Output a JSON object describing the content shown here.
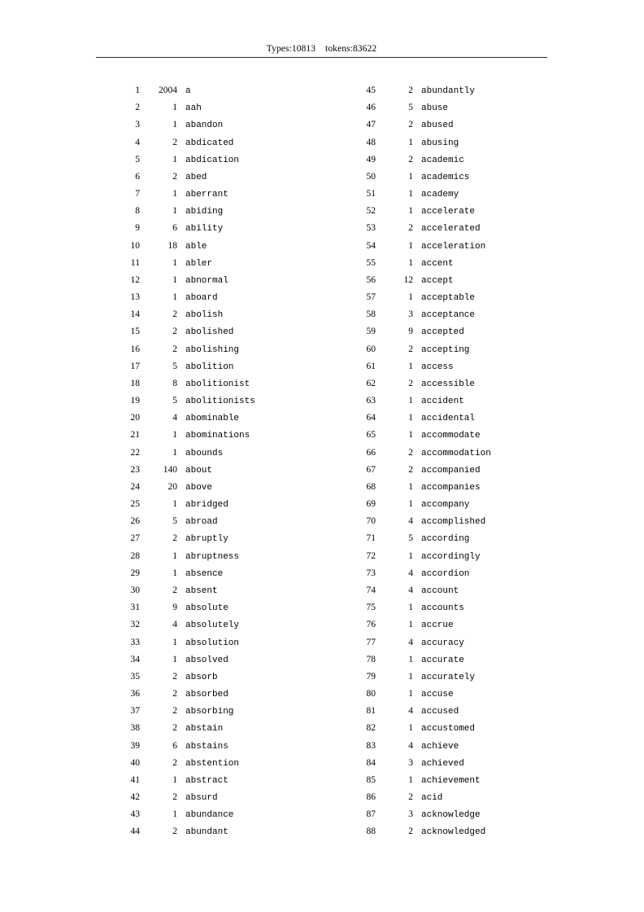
{
  "document": {
    "header": {
      "types_label": "Types:10813",
      "tokens_label": "tokens:83622",
      "full_text": "Types:10813    tokens:83622"
    },
    "columns": {
      "left": [
        {
          "rank": "1",
          "freq": "2004",
          "word": "a"
        },
        {
          "rank": "2",
          "freq": "1",
          "word": "aah"
        },
        {
          "rank": "3",
          "freq": "1",
          "word": "abandon"
        },
        {
          "rank": "4",
          "freq": "2",
          "word": "abdicated"
        },
        {
          "rank": "5",
          "freq": "1",
          "word": "abdication"
        },
        {
          "rank": "6",
          "freq": "2",
          "word": "abed"
        },
        {
          "rank": "7",
          "freq": "1",
          "word": "aberrant"
        },
        {
          "rank": "8",
          "freq": "1",
          "word": "abiding"
        },
        {
          "rank": "9",
          "freq": "6",
          "word": "ability"
        },
        {
          "rank": "10",
          "freq": "18",
          "word": "able"
        },
        {
          "rank": "11",
          "freq": "1",
          "word": "abler"
        },
        {
          "rank": "12",
          "freq": "1",
          "word": "abnormal"
        },
        {
          "rank": "13",
          "freq": "1",
          "word": "aboard"
        },
        {
          "rank": "14",
          "freq": "2",
          "word": "abolish"
        },
        {
          "rank": "15",
          "freq": "2",
          "word": "abolished"
        },
        {
          "rank": "16",
          "freq": "2",
          "word": "abolishing"
        },
        {
          "rank": "17",
          "freq": "5",
          "word": "abolition"
        },
        {
          "rank": "18",
          "freq": "8",
          "word": "abolitionist"
        },
        {
          "rank": "19",
          "freq": "5",
          "word": "abolitionists"
        },
        {
          "rank": "20",
          "freq": "4",
          "word": "abominable"
        },
        {
          "rank": "21",
          "freq": "1",
          "word": "abominations"
        },
        {
          "rank": "22",
          "freq": "1",
          "word": "abounds"
        },
        {
          "rank": "23",
          "freq": "140",
          "word": "about"
        },
        {
          "rank": "24",
          "freq": "20",
          "word": "above"
        },
        {
          "rank": "25",
          "freq": "1",
          "word": "abridged"
        },
        {
          "rank": "26",
          "freq": "5",
          "word": "abroad"
        },
        {
          "rank": "27",
          "freq": "2",
          "word": "abruptly"
        },
        {
          "rank": "28",
          "freq": "1",
          "word": "abruptness"
        },
        {
          "rank": "29",
          "freq": "1",
          "word": "absence"
        },
        {
          "rank": "30",
          "freq": "2",
          "word": "absent"
        },
        {
          "rank": "31",
          "freq": "9",
          "word": "absolute"
        },
        {
          "rank": "32",
          "freq": "4",
          "word": "absolutely"
        },
        {
          "rank": "33",
          "freq": "1",
          "word": "absolution"
        },
        {
          "rank": "34",
          "freq": "1",
          "word": "absolved"
        },
        {
          "rank": "35",
          "freq": "2",
          "word": "absorb"
        },
        {
          "rank": "36",
          "freq": "2",
          "word": "absorbed"
        },
        {
          "rank": "37",
          "freq": "2",
          "word": "absorbing"
        },
        {
          "rank": "38",
          "freq": "2",
          "word": "abstain"
        },
        {
          "rank": "39",
          "freq": "6",
          "word": "abstains"
        },
        {
          "rank": "40",
          "freq": "2",
          "word": "abstention"
        },
        {
          "rank": "41",
          "freq": "1",
          "word": "abstract"
        },
        {
          "rank": "42",
          "freq": "2",
          "word": "absurd"
        },
        {
          "rank": "43",
          "freq": "1",
          "word": "abundance"
        },
        {
          "rank": "44",
          "freq": "2",
          "word": "abundant"
        }
      ],
      "right": [
        {
          "rank": "45",
          "freq": "2",
          "word": "abundantly"
        },
        {
          "rank": "46",
          "freq": "5",
          "word": "abuse"
        },
        {
          "rank": "47",
          "freq": "2",
          "word": "abused"
        },
        {
          "rank": "48",
          "freq": "1",
          "word": "abusing"
        },
        {
          "rank": "49",
          "freq": "2",
          "word": "academic"
        },
        {
          "rank": "50",
          "freq": "1",
          "word": "academics"
        },
        {
          "rank": "51",
          "freq": "1",
          "word": "academy"
        },
        {
          "rank": "52",
          "freq": "1",
          "word": "accelerate"
        },
        {
          "rank": "53",
          "freq": "2",
          "word": "accelerated"
        },
        {
          "rank": "54",
          "freq": "1",
          "word": "acceleration"
        },
        {
          "rank": "55",
          "freq": "1",
          "word": "accent"
        },
        {
          "rank": "56",
          "freq": "12",
          "word": "accept"
        },
        {
          "rank": "57",
          "freq": "1",
          "word": "acceptable"
        },
        {
          "rank": "58",
          "freq": "3",
          "word": "acceptance"
        },
        {
          "rank": "59",
          "freq": "9",
          "word": "accepted"
        },
        {
          "rank": "60",
          "freq": "2",
          "word": "accepting"
        },
        {
          "rank": "61",
          "freq": "1",
          "word": "access"
        },
        {
          "rank": "62",
          "freq": "2",
          "word": "accessible"
        },
        {
          "rank": "63",
          "freq": "1",
          "word": "accident"
        },
        {
          "rank": "64",
          "freq": "1",
          "word": "accidental"
        },
        {
          "rank": "65",
          "freq": "1",
          "word": "accommodate"
        },
        {
          "rank": "66",
          "freq": "2",
          "word": "accommodation"
        },
        {
          "rank": "67",
          "freq": "2",
          "word": "accompanied"
        },
        {
          "rank": "68",
          "freq": "1",
          "word": "accompanies"
        },
        {
          "rank": "69",
          "freq": "1",
          "word": "accompany"
        },
        {
          "rank": "70",
          "freq": "4",
          "word": "accomplished"
        },
        {
          "rank": "71",
          "freq": "5",
          "word": "according"
        },
        {
          "rank": "72",
          "freq": "1",
          "word": "accordingly"
        },
        {
          "rank": "73",
          "freq": "4",
          "word": "accordion"
        },
        {
          "rank": "74",
          "freq": "4",
          "word": "account"
        },
        {
          "rank": "75",
          "freq": "1",
          "word": "accounts"
        },
        {
          "rank": "76",
          "freq": "1",
          "word": "accrue"
        },
        {
          "rank": "77",
          "freq": "4",
          "word": "accuracy"
        },
        {
          "rank": "78",
          "freq": "1",
          "word": "accurate"
        },
        {
          "rank": "79",
          "freq": "1",
          "word": "accurately"
        },
        {
          "rank": "80",
          "freq": "1",
          "word": "accuse"
        },
        {
          "rank": "81",
          "freq": "4",
          "word": "accused"
        },
        {
          "rank": "82",
          "freq": "1",
          "word": "accustomed"
        },
        {
          "rank": "83",
          "freq": "4",
          "word": "achieve"
        },
        {
          "rank": "84",
          "freq": "3",
          "word": "achieved"
        },
        {
          "rank": "85",
          "freq": "1",
          "word": "achievement"
        },
        {
          "rank": "86",
          "freq": "2",
          "word": "acid"
        },
        {
          "rank": "87",
          "freq": "3",
          "word": "acknowledge"
        },
        {
          "rank": "88",
          "freq": "2",
          "word": "acknowledged"
        }
      ]
    }
  }
}
